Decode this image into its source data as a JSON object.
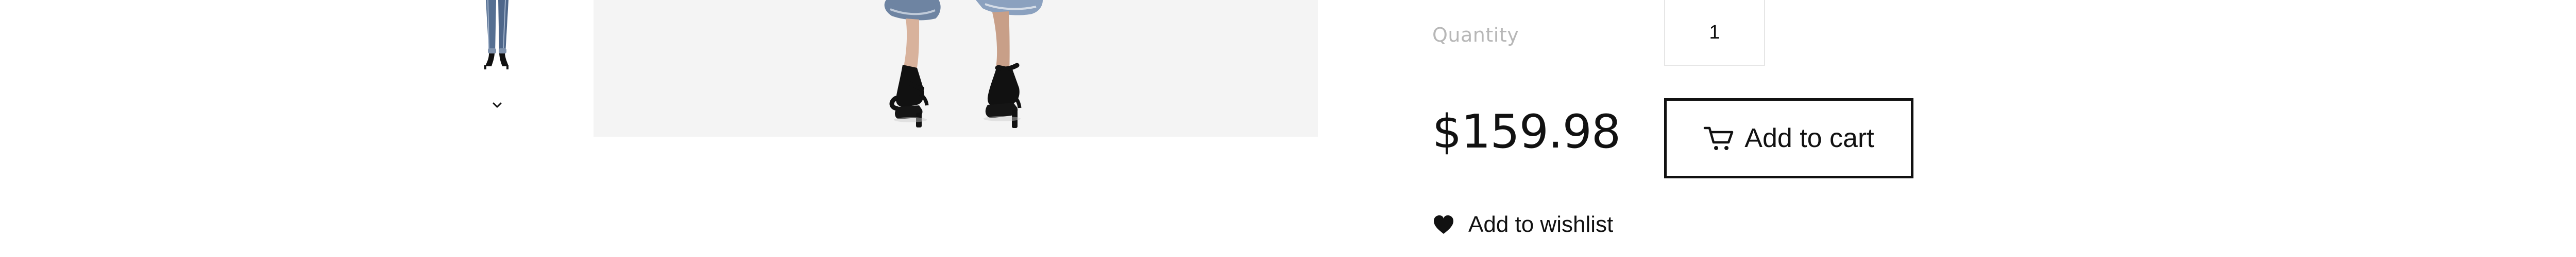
{
  "gallery": {
    "thumbnail_alt": "jeans and heels",
    "main_image_alt": "jeans and heels",
    "scroll_down_icon": "chevron-down-icon"
  },
  "product": {
    "quantity_label": "Quantity",
    "quantity_value": "1",
    "price": "$159.98",
    "add_to_cart_label": "Add to cart",
    "add_to_cart_icon": "cart-icon",
    "wishlist_label": "Add to wishlist",
    "wishlist_icon": "heart-icon"
  },
  "colors": {
    "main_image_background": "#f4f4f4",
    "muted_label": "#b7b7b7",
    "text": "#111111"
  }
}
